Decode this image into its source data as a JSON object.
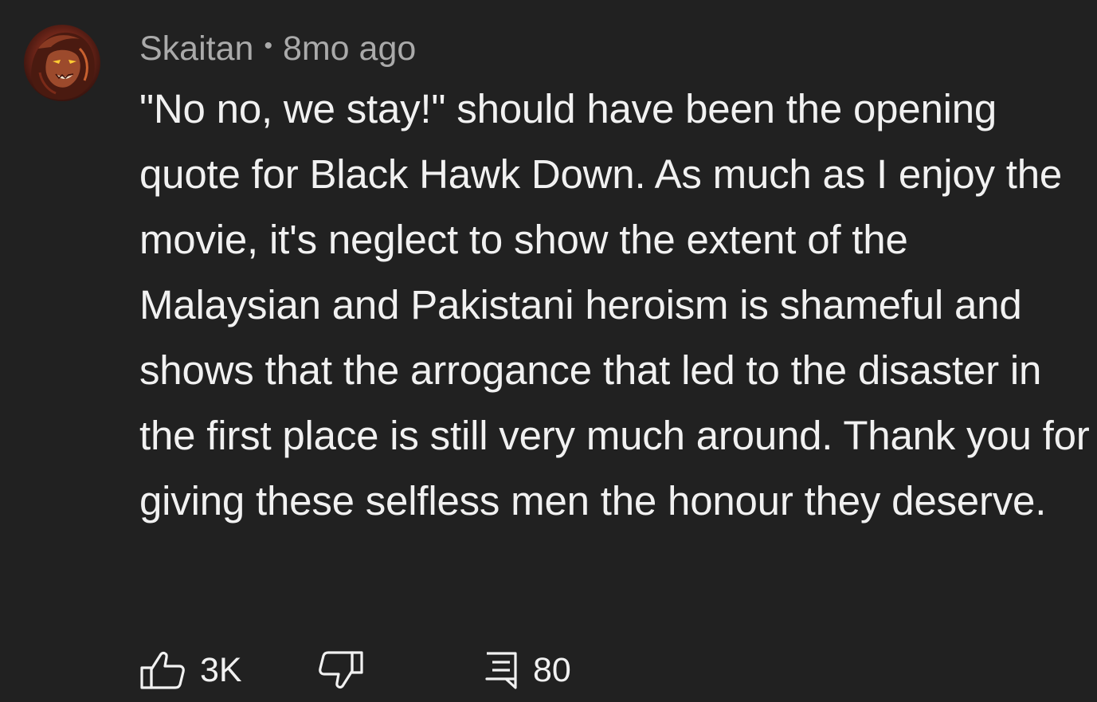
{
  "comment": {
    "author": "Skaitan",
    "separator": "•",
    "timestamp": "8mo ago",
    "text": "\"No no, we stay!\" should have been the opening quote for Black Hawk Down. As much as I enjoy the movie, it's neglect to show the extent of the Malaysian and Pakistani heroism is shameful and shows that the arrogance that led to the disaster in the first place is still very much around. Thank you for giving these selfless men the honour they deserve.",
    "avatar_icon": "avatar-portrait",
    "actions": {
      "like_icon": "thumbs-up-icon",
      "like_count": "3K",
      "dislike_icon": "thumbs-down-icon",
      "reply_icon": "reply-comment-icon",
      "reply_count": "80"
    }
  },
  "colors": {
    "background": "#212121",
    "text_primary": "#f1f1f1",
    "text_secondary": "#aaaaaa"
  }
}
